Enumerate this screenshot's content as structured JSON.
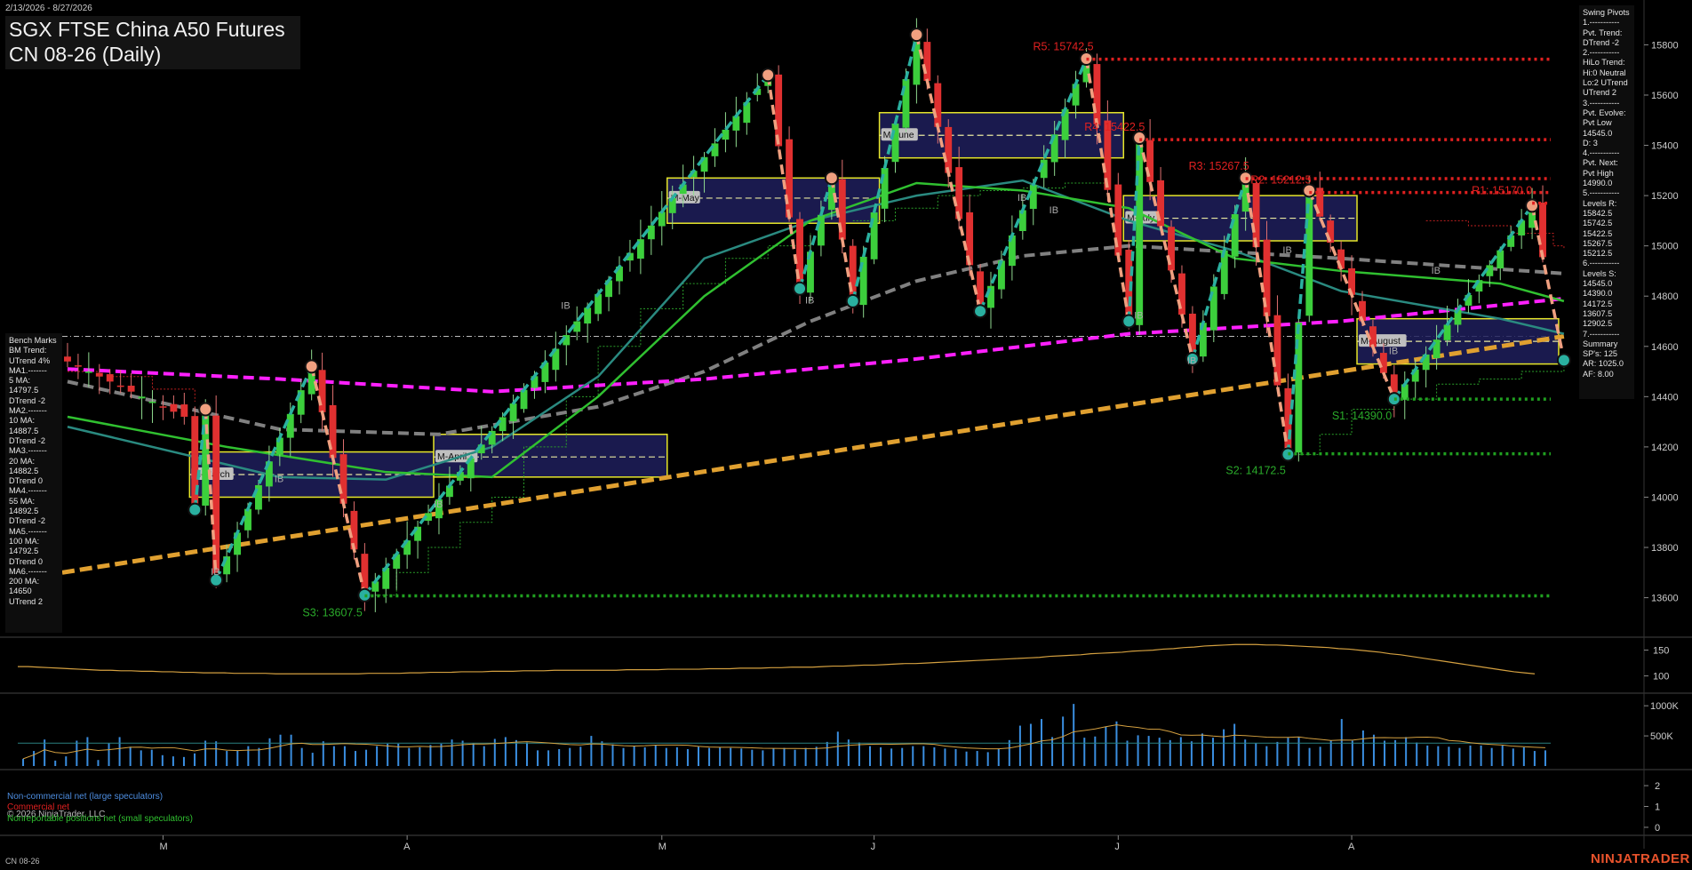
{
  "header": {
    "date_range": "2/13/2026 - 8/27/2026",
    "title_line1": "SGX FTSE China A50 Futures",
    "title_line2": "CN 08-26 (Daily)"
  },
  "swing_panel": {
    "lines": [
      "Swing Pivots",
      "1.-----------",
      "Pvt. Trend:",
      "DTrend -2",
      "2.-----------",
      "HiLo Trend:",
      "Hi:0 Neutral",
      "Lo:2 UTrend",
      "UTrend 2",
      "3.-----------",
      "Pvt. Evolve:",
      "Pvt Low",
      "14545.0",
      "D: 3",
      "4.-----------",
      "Pvt. Next:",
      "Pvt High",
      "14990.0",
      "5.-----------",
      "Levels R:",
      "15842.5",
      "15742.5",
      "15422.5",
      "15267.5",
      "15212.5",
      "6.-----------",
      "Levels S:",
      "14545.0",
      "14390.0",
      "14172.5",
      "13607.5",
      "12902.5",
      "7.-----------",
      "Summary",
      "SP's: 125",
      "AR: 1025.0",
      "AF: 8.00"
    ]
  },
  "bench_panel": {
    "lines": [
      "Bench Marks",
      "BM Trend:",
      "UTrend 4%",
      "MA1.-------",
      "5 MA:",
      "14797.5",
      "DTrend -2",
      "MA2.-------",
      "10 MA:",
      "14887.5",
      "DTrend -2",
      "MA3.-------",
      "20 MA:",
      "14882.5",
      "DTrend 0",
      "MA4.-------",
      "55 MA:",
      "14892.5",
      "DTrend -2",
      "MA5.-------",
      "100 MA:",
      "14792.5",
      "DTrend 0",
      "MA6.-------",
      "200 MA:",
      "14650",
      "UTrend 2"
    ]
  },
  "footer": {
    "copyright": "© 2026 NinjaTrader, LLC",
    "instrument": "CN 08-26",
    "brand": "NINJATRADER"
  },
  "legend": [
    {
      "label": "Non-commercial net (large speculators)",
      "color": "#4d8de0"
    },
    {
      "label": "Commercial net",
      "color": "#e02020"
    },
    {
      "label": "Nonreportable positions net (small speculators)",
      "color": "#30c030"
    }
  ],
  "colors": {
    "up_candle": "#3ccf3c",
    "down_candle": "#e03030",
    "pivot_high": "#f0a080",
    "pivot_low": "#2ab0a0",
    "ma200": "#e0a030",
    "ma100": "#ff20ff",
    "ma55": "#808080",
    "ma20": "#30c030",
    "ma10": "#2a8a80",
    "resistance": "#e02020",
    "support": "#20a020",
    "volume": "#3a8ee0",
    "zone_fill": "#1e1e5c",
    "zone_border": "#e6e62a"
  },
  "chart_data": [
    {
      "type": "candlestick",
      "panel": "price",
      "ylim": [
        13450,
        15950
      ],
      "y_ticks": [
        13600,
        13800,
        14000,
        14200,
        14400,
        14600,
        14800,
        15000,
        15200,
        15400,
        15600,
        15800
      ],
      "x_ticks": [
        "M",
        "A",
        "M",
        "J",
        "J",
        "A"
      ],
      "x_tick_bars": [
        9,
        32,
        56,
        76,
        99,
        121
      ],
      "n_bars": 140,
      "zigzag": [
        {
          "bar": 12,
          "price": 13950
        },
        {
          "bar": 13,
          "price": 14350
        },
        {
          "bar": 14,
          "price": 13670
        },
        {
          "bar": 23,
          "price": 14520
        },
        {
          "bar": 28,
          "price": 13610
        },
        {
          "bar": 66,
          "price": 15680
        },
        {
          "bar": 69,
          "price": 14830
        },
        {
          "bar": 72,
          "price": 15270
        },
        {
          "bar": 74,
          "price": 14780
        },
        {
          "bar": 80,
          "price": 15840
        },
        {
          "bar": 86,
          "price": 14740
        },
        {
          "bar": 96,
          "price": 15745
        },
        {
          "bar": 100,
          "price": 14700
        },
        {
          "bar": 101,
          "price": 15430
        },
        {
          "bar": 106,
          "price": 14550
        },
        {
          "bar": 111,
          "price": 15270
        },
        {
          "bar": 115,
          "price": 14170
        },
        {
          "bar": 117,
          "price": 15220
        },
        {
          "bar": 125,
          "price": 14390
        },
        {
          "bar": 138,
          "price": 15160
        },
        {
          "bar": 141,
          "price": 14545
        }
      ],
      "resistance_levels": [
        {
          "label": "R5: 15742.5",
          "value": 15742.5
        },
        {
          "label": "R4: 15422.5",
          "value": 15422.5
        },
        {
          "label": "R3: 15267.5",
          "value": 15267.5
        },
        {
          "label": "R2: 15212.5",
          "value": 15212.5
        },
        {
          "label": "R1: 15170.0",
          "value": 15170.0
        }
      ],
      "support_levels": [
        {
          "label": "S1: 14390.0",
          "value": 14390.0
        },
        {
          "label": "S2: 14172.5",
          "value": 14172.5
        },
        {
          "label": "S3: 13607.5",
          "value": 13607.5
        }
      ],
      "monthly_zones": [
        {
          "label": "M-March",
          "bar_from": 12,
          "bar_to": 34,
          "low": 14000,
          "high": 14180,
          "mid": 14090
        },
        {
          "label": "M-April",
          "bar_from": 35,
          "bar_to": 56,
          "low": 14080,
          "high": 14250,
          "mid": 14160
        },
        {
          "label": "M-May",
          "bar_from": 57,
          "bar_to": 76,
          "low": 15090,
          "high": 15270,
          "mid": 15190
        },
        {
          "label": "M-June",
          "bar_from": 77,
          "bar_to": 99,
          "low": 15350,
          "high": 15530,
          "mid": 15440
        },
        {
          "label": "M-July",
          "bar_from": 100,
          "bar_to": 121,
          "low": 15020,
          "high": 15200,
          "mid": 15110
        },
        {
          "label": "M-August",
          "bar_from": 122,
          "bar_to": 140,
          "low": 14530,
          "high": 14710,
          "mid": 14620
        }
      ],
      "ib_labels": [
        {
          "bar": 14,
          "price": 13690
        },
        {
          "bar": 20,
          "price": 14060
        },
        {
          "bar": 35,
          "price": 13960
        },
        {
          "bar": 47,
          "price": 14750
        },
        {
          "bar": 70,
          "price": 14770
        },
        {
          "bar": 90,
          "price": 15180
        },
        {
          "bar": 93,
          "price": 15130
        },
        {
          "bar": 101,
          "price": 14710
        },
        {
          "bar": 106,
          "price": 14530
        },
        {
          "bar": 115,
          "price": 14970
        },
        {
          "bar": 125,
          "price": 14570
        },
        {
          "bar": 129,
          "price": 14890
        }
      ],
      "ma_lines": {
        "ma200": {
          "from": 13700,
          "to": 14640
        },
        "ma100": [
          [
            0,
            14510
          ],
          [
            20,
            14470
          ],
          [
            40,
            14420
          ],
          [
            60,
            14470
          ],
          [
            80,
            14550
          ],
          [
            100,
            14650
          ],
          [
            120,
            14700
          ],
          [
            141,
            14790
          ]
        ],
        "ma55": [
          [
            0,
            14460
          ],
          [
            20,
            14270
          ],
          [
            35,
            14250
          ],
          [
            50,
            14360
          ],
          [
            60,
            14500
          ],
          [
            70,
            14700
          ],
          [
            80,
            14860
          ],
          [
            90,
            14960
          ],
          [
            100,
            15000
          ],
          [
            120,
            14950
          ],
          [
            141,
            14890
          ]
        ],
        "ma20": [
          [
            0,
            14320
          ],
          [
            15,
            14200
          ],
          [
            30,
            14100
          ],
          [
            40,
            14080
          ],
          [
            50,
            14400
          ],
          [
            60,
            14800
          ],
          [
            70,
            15100
          ],
          [
            80,
            15250
          ],
          [
            90,
            15220
          ],
          [
            100,
            15150
          ],
          [
            110,
            14950
          ],
          [
            120,
            14900
          ],
          [
            135,
            14850
          ],
          [
            141,
            14780
          ]
        ],
        "ma10": [
          [
            0,
            14280
          ],
          [
            20,
            14080
          ],
          [
            30,
            14070
          ],
          [
            40,
            14200
          ],
          [
            50,
            14480
          ],
          [
            60,
            14950
          ],
          [
            70,
            15100
          ],
          [
            80,
            15200
          ],
          [
            90,
            15260
          ],
          [
            100,
            15100
          ],
          [
            110,
            14980
          ],
          [
            120,
            14820
          ],
          [
            135,
            14710
          ],
          [
            141,
            14650
          ]
        ]
      }
    },
    {
      "type": "line",
      "panel": "indicator",
      "ylim": [
        70,
        170
      ],
      "y_ticks": [
        100,
        150
      ],
      "values": [
        118,
        118,
        117,
        116,
        115,
        114,
        113,
        112,
        111,
        111,
        110,
        110,
        109,
        109,
        108,
        108,
        107,
        107,
        106,
        106,
        106,
        105,
        105,
        105,
        105,
        104,
        104,
        104,
        104,
        104,
        104,
        104,
        104,
        104,
        105,
        105,
        105,
        105,
        106,
        106,
        107,
        107,
        107,
        108,
        108,
        108,
        109,
        109,
        109,
        110,
        110,
        110,
        111,
        111,
        111,
        111,
        111,
        111,
        111,
        112,
        112,
        112,
        112,
        113,
        113,
        113,
        113,
        114,
        114,
        114,
        115,
        115,
        115,
        116,
        116,
        117,
        117,
        117,
        118,
        119,
        119,
        120,
        121,
        121,
        122,
        123,
        124,
        124,
        125,
        126,
        127,
        128,
        129,
        130,
        131,
        132,
        133,
        134,
        135,
        136,
        138,
        139,
        140,
        141,
        143,
        144,
        145,
        146,
        148,
        149,
        150,
        152,
        153,
        155,
        156,
        158,
        159,
        160,
        161,
        161,
        161,
        160,
        160,
        159,
        158,
        157,
        156,
        155,
        153,
        152,
        150,
        148,
        146,
        143,
        141,
        138,
        135,
        132,
        129,
        126,
        123,
        120,
        117,
        114,
        111,
        108,
        106,
        104
      ]
    },
    {
      "type": "bar",
      "panel": "volume",
      "ylim": [
        0,
        1150000
      ],
      "y_ticks": [
        500000,
        1000000
      ],
      "y_tick_labels": [
        "500K",
        "1000K"
      ],
      "average": 380000,
      "values": [
        120000,
        250000,
        440000,
        90000,
        160000,
        420000,
        480000,
        100000,
        380000,
        480000,
        320000,
        260000,
        270000,
        180000,
        160000,
        150000,
        210000,
        420000,
        410000,
        250000,
        260000,
        330000,
        300000,
        460000,
        520000,
        520000,
        300000,
        220000,
        410000,
        330000,
        330000,
        250000,
        270000,
        330000,
        370000,
        370000,
        300000,
        310000,
        350000,
        370000,
        440000,
        420000,
        380000,
        330000,
        450000,
        480000,
        430000,
        390000,
        260000,
        260000,
        280000,
        300000,
        320000,
        500000,
        410000,
        360000,
        300000,
        330000,
        310000,
        350000,
        300000,
        310000,
        280000,
        320000,
        300000,
        310000,
        300000,
        290000,
        270000,
        260000,
        290000,
        300000,
        270000,
        300000,
        320000,
        400000,
        570000,
        440000,
        390000,
        330000,
        310000,
        290000,
        300000,
        330000,
        330000,
        310000,
        290000,
        280000,
        240000,
        250000,
        230000,
        290000,
        430000,
        670000,
        700000,
        780000,
        480000,
        820000,
        1030000,
        470000,
        490000,
        650000,
        740000,
        420000,
        510000,
        500000,
        470000,
        430000,
        480000,
        410000,
        540000,
        470000,
        610000,
        700000,
        440000,
        380000,
        330000,
        400000,
        470000,
        480000,
        300000,
        320000,
        420000,
        780000,
        420000,
        590000,
        520000,
        420000,
        430000,
        480000,
        390000,
        340000,
        330000,
        320000,
        300000,
        340000,
        340000,
        300000,
        340000,
        290000,
        310000,
        250000,
        260000
      ]
    },
    {
      "type": "line",
      "panel": "cot",
      "ylim": [
        -0.3,
        2.6
      ],
      "y_ticks": [
        0,
        1,
        2
      ],
      "series": [
        {
          "name": "Non-commercial net (large speculators)",
          "values": []
        },
        {
          "name": "Commercial net",
          "values": []
        },
        {
          "name": "Nonreportable positions net (small speculators)",
          "values": []
        }
      ]
    }
  ]
}
